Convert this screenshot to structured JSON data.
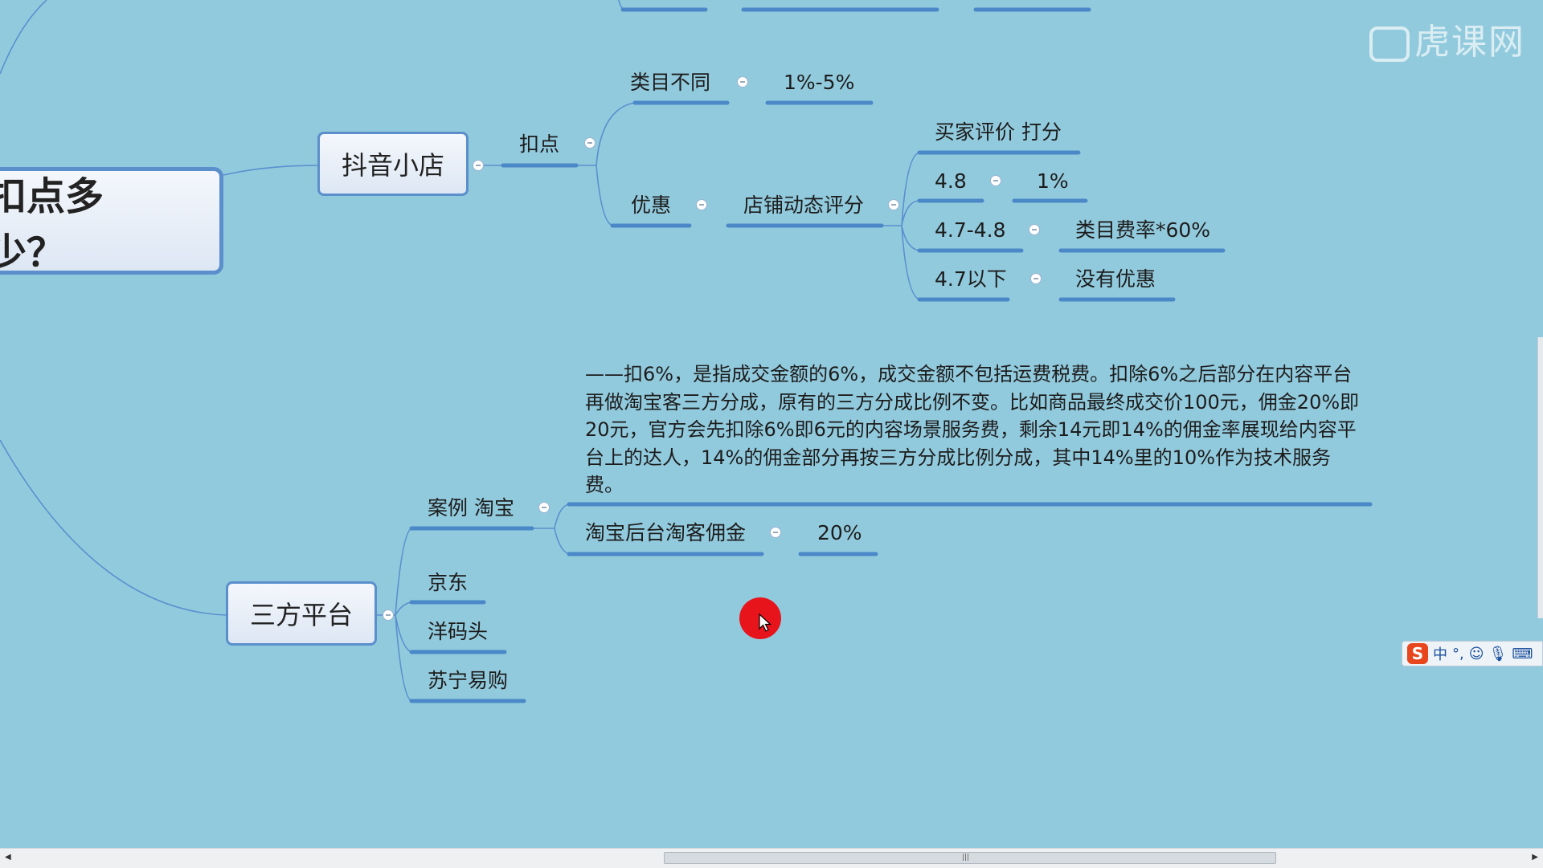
{
  "watermark": "虎课网",
  "root": {
    "title": "扣点多少？"
  },
  "douyin": {
    "title": "抖音小店",
    "koudian": {
      "label": "扣点",
      "category": {
        "label": "类目不同",
        "value": "1%-5%"
      }
    },
    "youhui": {
      "label": "优惠",
      "dsr": {
        "label": "店铺动态评分",
        "note": "买家评价 打分",
        "rows": [
          {
            "score": "4.8",
            "result": "1%"
          },
          {
            "score": "4.7-4.8",
            "result": "类目费率*60%"
          },
          {
            "score": "4.7以下",
            "result": "没有优惠"
          }
        ]
      }
    }
  },
  "sanfang": {
    "title": "三方平台",
    "taobao": {
      "label": "案例 淘宝",
      "note": "——扣6%，是指成交金额的6%，成交金额不包括运费税费。扣除6%之后部分在内容平台再做淘宝客三方分成，原有的三方分成比例不变。比如商品最终成交价100元，佣金20%即20元，官方会先扣除6%即6元的内容场景服务费，剩余14元即14%的佣金率展现给内容平台上的达人，14%的佣金部分再按三方分成比例分成，其中14%里的10%作为技术服务费。",
      "commission": {
        "label": "淘宝后台淘客佣金",
        "value": "20%"
      }
    },
    "others": [
      "京东",
      "洋码头",
      "苏宁易购"
    ]
  },
  "ime": {
    "logo": "S",
    "lang": "中",
    "punct": "°,",
    "icons": [
      "emoji-icon",
      "mic-icon",
      "keyboard-icon"
    ]
  },
  "colors": {
    "background": "#92cadd",
    "line": "#4a88c8",
    "node_border": "#5a8fcc",
    "cursor": "#e8141c"
  }
}
